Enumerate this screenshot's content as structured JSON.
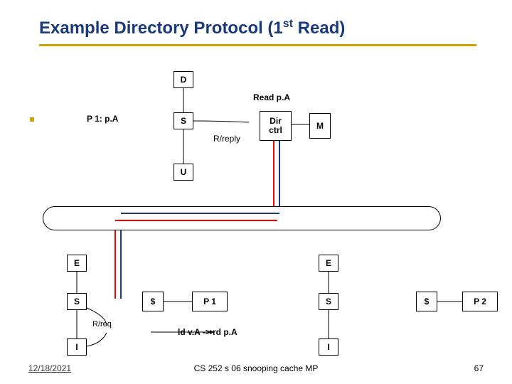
{
  "title_parts": {
    "pre": "Example Directory Protocol (1",
    "sup": "st",
    "post": " Read)"
  },
  "read_label": "Read p.A",
  "p1_label": "P 1: p.A",
  "states": {
    "D": "D",
    "S": "S",
    "U": "U",
    "E": "E",
    "I": "I"
  },
  "r_reply": "R/reply",
  "dir_ctrl": {
    "line1": "Dir",
    "line2": "ctrl"
  },
  "M": "M",
  "dollar": "$",
  "P1": "P 1",
  "P2": "P 2",
  "r_req": "R/req",
  "load_line": "ld v.A -> rd p.A",
  "date": "12/18/2021",
  "footer": "CS 252 s 06 snooping cache MP",
  "page": "67"
}
